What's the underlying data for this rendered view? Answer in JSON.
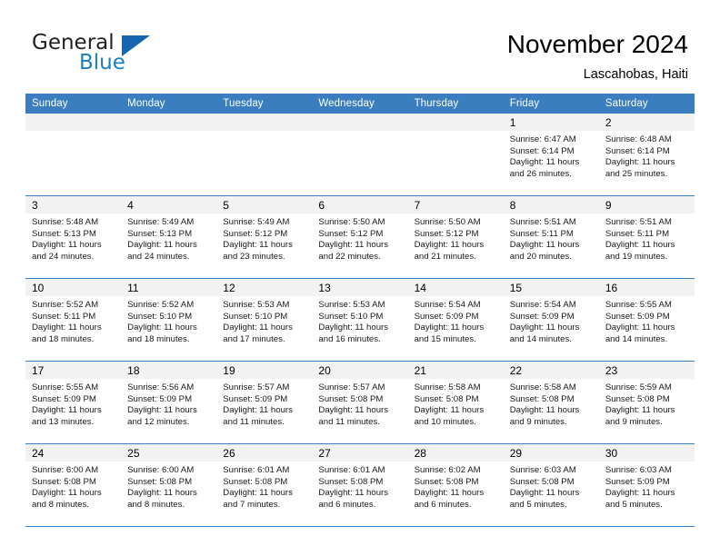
{
  "brand": {
    "word_one": "General",
    "word_two": "Blue",
    "logo_icon": "triangle-flag-icon"
  },
  "header": {
    "title": "November 2024",
    "subtitle": "Lascahobas, Haiti"
  },
  "calendar": {
    "weekday_headers": [
      "Sunday",
      "Monday",
      "Tuesday",
      "Wednesday",
      "Thursday",
      "Friday",
      "Saturday"
    ],
    "accent_color": "#3a7ebf",
    "daynum_bg": "#f2f2f2",
    "weeks": [
      [
        {
          "day": "",
          "empty": true
        },
        {
          "day": "",
          "empty": true
        },
        {
          "day": "",
          "empty": true
        },
        {
          "day": "",
          "empty": true
        },
        {
          "day": "",
          "empty": true
        },
        {
          "day": "1",
          "sunrise": "Sunrise: 6:47 AM",
          "sunset": "Sunset: 6:14 PM",
          "daylight": "Daylight: 11 hours and 26 minutes."
        },
        {
          "day": "2",
          "sunrise": "Sunrise: 6:48 AM",
          "sunset": "Sunset: 6:14 PM",
          "daylight": "Daylight: 11 hours and 25 minutes."
        }
      ],
      [
        {
          "day": "3",
          "sunrise": "Sunrise: 5:48 AM",
          "sunset": "Sunset: 5:13 PM",
          "daylight": "Daylight: 11 hours and 24 minutes."
        },
        {
          "day": "4",
          "sunrise": "Sunrise: 5:49 AM",
          "sunset": "Sunset: 5:13 PM",
          "daylight": "Daylight: 11 hours and 24 minutes."
        },
        {
          "day": "5",
          "sunrise": "Sunrise: 5:49 AM",
          "sunset": "Sunset: 5:12 PM",
          "daylight": "Daylight: 11 hours and 23 minutes."
        },
        {
          "day": "6",
          "sunrise": "Sunrise: 5:50 AM",
          "sunset": "Sunset: 5:12 PM",
          "daylight": "Daylight: 11 hours and 22 minutes."
        },
        {
          "day": "7",
          "sunrise": "Sunrise: 5:50 AM",
          "sunset": "Sunset: 5:12 PM",
          "daylight": "Daylight: 11 hours and 21 minutes."
        },
        {
          "day": "8",
          "sunrise": "Sunrise: 5:51 AM",
          "sunset": "Sunset: 5:11 PM",
          "daylight": "Daylight: 11 hours and 20 minutes."
        },
        {
          "day": "9",
          "sunrise": "Sunrise: 5:51 AM",
          "sunset": "Sunset: 5:11 PM",
          "daylight": "Daylight: 11 hours and 19 minutes."
        }
      ],
      [
        {
          "day": "10",
          "sunrise": "Sunrise: 5:52 AM",
          "sunset": "Sunset: 5:11 PM",
          "daylight": "Daylight: 11 hours and 18 minutes."
        },
        {
          "day": "11",
          "sunrise": "Sunrise: 5:52 AM",
          "sunset": "Sunset: 5:10 PM",
          "daylight": "Daylight: 11 hours and 18 minutes."
        },
        {
          "day": "12",
          "sunrise": "Sunrise: 5:53 AM",
          "sunset": "Sunset: 5:10 PM",
          "daylight": "Daylight: 11 hours and 17 minutes."
        },
        {
          "day": "13",
          "sunrise": "Sunrise: 5:53 AM",
          "sunset": "Sunset: 5:10 PM",
          "daylight": "Daylight: 11 hours and 16 minutes."
        },
        {
          "day": "14",
          "sunrise": "Sunrise: 5:54 AM",
          "sunset": "Sunset: 5:09 PM",
          "daylight": "Daylight: 11 hours and 15 minutes."
        },
        {
          "day": "15",
          "sunrise": "Sunrise: 5:54 AM",
          "sunset": "Sunset: 5:09 PM",
          "daylight": "Daylight: 11 hours and 14 minutes."
        },
        {
          "day": "16",
          "sunrise": "Sunrise: 5:55 AM",
          "sunset": "Sunset: 5:09 PM",
          "daylight": "Daylight: 11 hours and 14 minutes."
        }
      ],
      [
        {
          "day": "17",
          "sunrise": "Sunrise: 5:55 AM",
          "sunset": "Sunset: 5:09 PM",
          "daylight": "Daylight: 11 hours and 13 minutes."
        },
        {
          "day": "18",
          "sunrise": "Sunrise: 5:56 AM",
          "sunset": "Sunset: 5:09 PM",
          "daylight": "Daylight: 11 hours and 12 minutes."
        },
        {
          "day": "19",
          "sunrise": "Sunrise: 5:57 AM",
          "sunset": "Sunset: 5:09 PM",
          "daylight": "Daylight: 11 hours and 11 minutes."
        },
        {
          "day": "20",
          "sunrise": "Sunrise: 5:57 AM",
          "sunset": "Sunset: 5:08 PM",
          "daylight": "Daylight: 11 hours and 11 minutes."
        },
        {
          "day": "21",
          "sunrise": "Sunrise: 5:58 AM",
          "sunset": "Sunset: 5:08 PM",
          "daylight": "Daylight: 11 hours and 10 minutes."
        },
        {
          "day": "22",
          "sunrise": "Sunrise: 5:58 AM",
          "sunset": "Sunset: 5:08 PM",
          "daylight": "Daylight: 11 hours and 9 minutes."
        },
        {
          "day": "23",
          "sunrise": "Sunrise: 5:59 AM",
          "sunset": "Sunset: 5:08 PM",
          "daylight": "Daylight: 11 hours and 9 minutes."
        }
      ],
      [
        {
          "day": "24",
          "sunrise": "Sunrise: 6:00 AM",
          "sunset": "Sunset: 5:08 PM",
          "daylight": "Daylight: 11 hours and 8 minutes."
        },
        {
          "day": "25",
          "sunrise": "Sunrise: 6:00 AM",
          "sunset": "Sunset: 5:08 PM",
          "daylight": "Daylight: 11 hours and 8 minutes."
        },
        {
          "day": "26",
          "sunrise": "Sunrise: 6:01 AM",
          "sunset": "Sunset: 5:08 PM",
          "daylight": "Daylight: 11 hours and 7 minutes."
        },
        {
          "day": "27",
          "sunrise": "Sunrise: 6:01 AM",
          "sunset": "Sunset: 5:08 PM",
          "daylight": "Daylight: 11 hours and 6 minutes."
        },
        {
          "day": "28",
          "sunrise": "Sunrise: 6:02 AM",
          "sunset": "Sunset: 5:08 PM",
          "daylight": "Daylight: 11 hours and 6 minutes."
        },
        {
          "day": "29",
          "sunrise": "Sunrise: 6:03 AM",
          "sunset": "Sunset: 5:08 PM",
          "daylight": "Daylight: 11 hours and 5 minutes."
        },
        {
          "day": "30",
          "sunrise": "Sunrise: 6:03 AM",
          "sunset": "Sunset: 5:09 PM",
          "daylight": "Daylight: 11 hours and 5 minutes."
        }
      ]
    ]
  }
}
